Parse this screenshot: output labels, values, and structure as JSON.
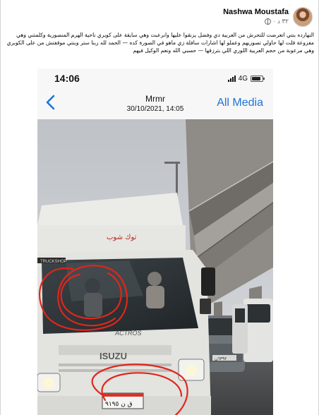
{
  "post": {
    "author": "Nashwa Moustafa",
    "time": "٣٢ د",
    "text": "النهارده بنتي اتعرضت للتحرش من العربية دي وفضل يزنقوا عليها وانرعبت وهي سايقة على كوبري ناحية الهرم المنصورية وكلمتني وهي مفزوعة قلت لها حاولي تصوريهم وعملو لها اشارات سافلة زي ماهو في الصورة كده — الحمد لله ربنا ستر وبنتي موقفتش من على الكوبري وهي مرعوبة من حجم العربية اللوري اللي بترزقها — حسبي الله ونعم الوكيل فيهم"
  },
  "phone": {
    "status_time": "14:06",
    "network": "4G",
    "battery_level": 0.85,
    "chat_name": "Mrmr",
    "chat_datetime": "30/10/2021, 14:05",
    "all_media_label": "All Media"
  },
  "truck": {
    "brand": "ISUZU",
    "model": "ACTROS",
    "header_text": "توك شوب",
    "plate": "ق ن ٩١٩٥",
    "side_plate": "٦٣٩٢ن"
  },
  "colors": {
    "ios_blue": "#1d73d8",
    "annotation_red": "#e0261b",
    "sky": "#c9ccd0",
    "truck_white": "#e8e8e6"
  }
}
